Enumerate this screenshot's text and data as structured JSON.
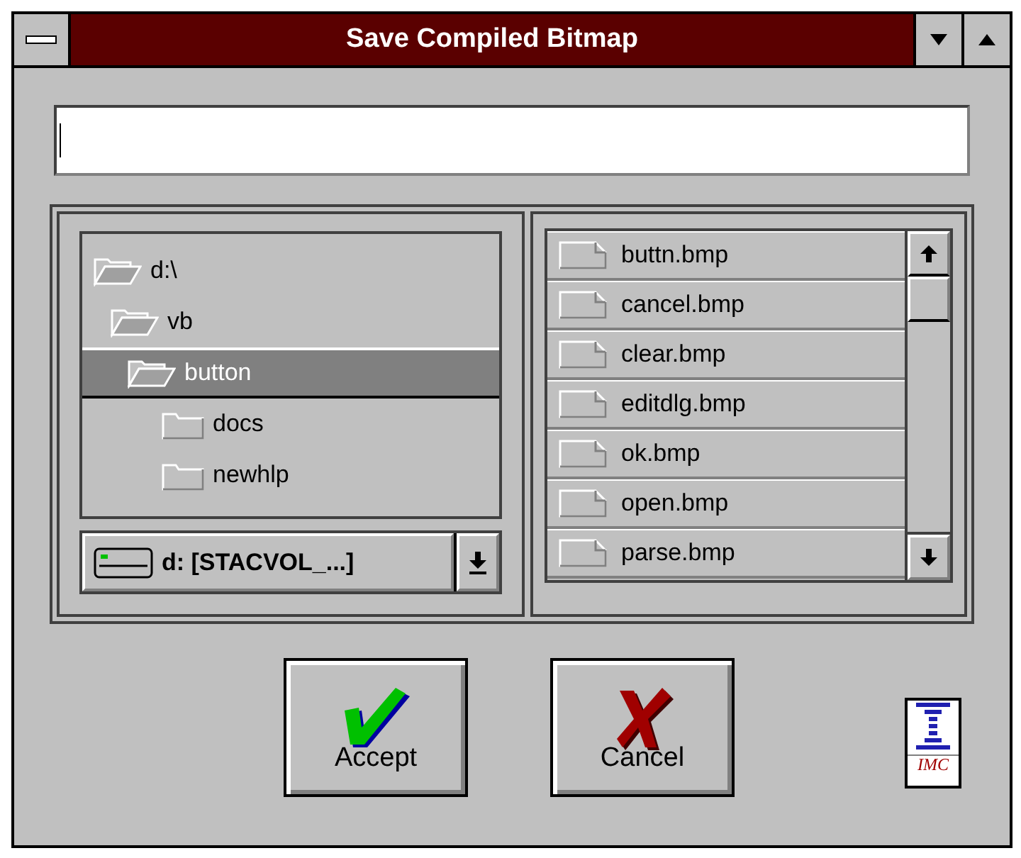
{
  "window": {
    "title": "Save Compiled Bitmap"
  },
  "folders": [
    {
      "name": "d:\\",
      "expanded": true,
      "selected": false,
      "children": [
        {
          "name": "vb",
          "expanded": true,
          "selected": false,
          "children": [
            {
              "name": "button",
              "expanded": true,
              "selected": true,
              "children": [
                {
                  "name": "docs",
                  "expanded": false,
                  "selected": false
                },
                {
                  "name": "newhlp",
                  "expanded": false,
                  "selected": false
                }
              ]
            }
          ]
        }
      ]
    }
  ],
  "drive": {
    "label": "d: [STACVOL_...]"
  },
  "files": [
    {
      "name": "buttn.bmp"
    },
    {
      "name": "cancel.bmp"
    },
    {
      "name": "clear.bmp"
    },
    {
      "name": "editdlg.bmp"
    },
    {
      "name": "ok.bmp"
    },
    {
      "name": "open.bmp"
    },
    {
      "name": "parse.bmp"
    }
  ],
  "buttons": [
    {
      "kind": "accept",
      "label": "Accept"
    },
    {
      "kind": "cancel",
      "label": "Cancel"
    }
  ],
  "logo": {
    "text": "IMC"
  }
}
